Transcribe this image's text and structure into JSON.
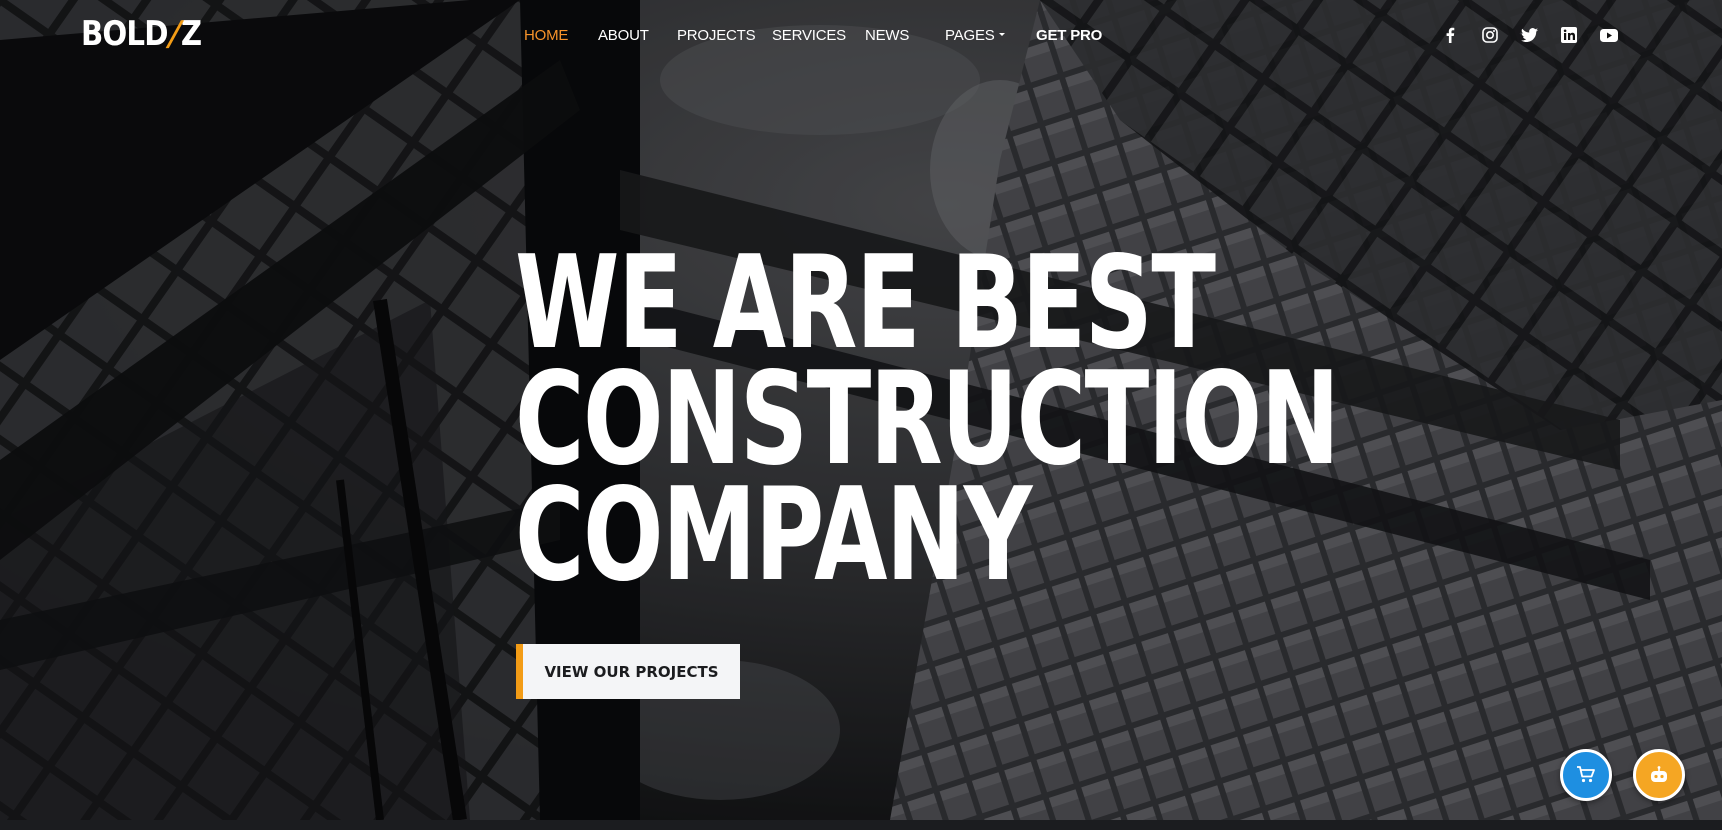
{
  "brand": {
    "logo_left": "BOLD",
    "logo_slash": "/",
    "logo_right": "Z",
    "accent": "#f39c16"
  },
  "nav": {
    "items": [
      {
        "label": "HOME"
      },
      {
        "label": "ABOUT"
      },
      {
        "label": "PROJECTS"
      },
      {
        "label": "SERVICES"
      },
      {
        "label": "NEWS"
      },
      {
        "label": "PAGES"
      },
      {
        "label": "GET PRO"
      }
    ],
    "active_color": "#f7932a"
  },
  "social": [
    "facebook-icon",
    "instagram-icon",
    "twitter-icon",
    "linkedin-icon",
    "youtube-icon"
  ],
  "hero": {
    "line1": "WE ARE BEST",
    "line2": "CONSTRUCTION",
    "line3": "COMPANY",
    "cta_label": "VIEW OUR PROJECTS"
  },
  "widgets": {
    "cart_color": "#1e8fe1",
    "bot_color": "#f5a623"
  }
}
